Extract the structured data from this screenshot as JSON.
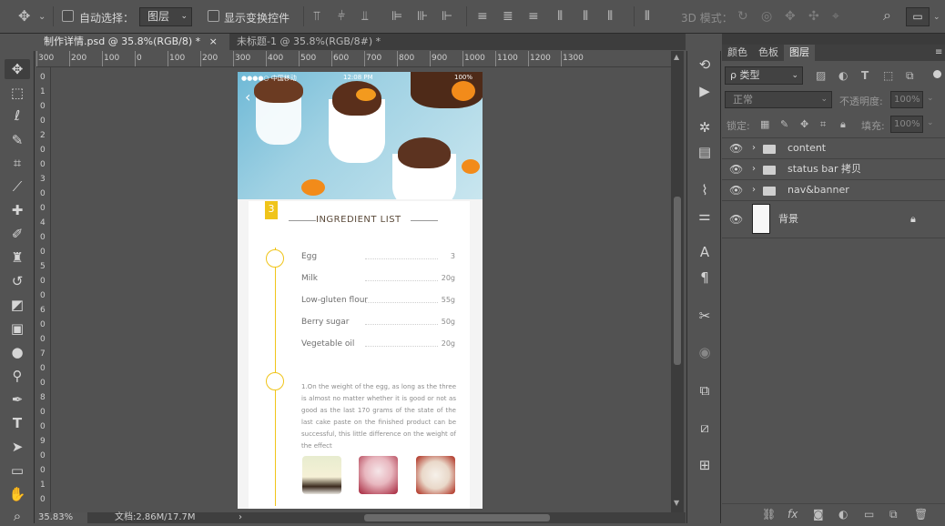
{
  "options": {
    "auto_select_label": "自动选择：",
    "layer_select_value": "图层",
    "show_transform_label": "显示变换控件",
    "mode_3d_label": "3D 模式："
  },
  "tabs": [
    {
      "title": "制作详情.psd @ 35.8%(RGB/8) *",
      "close": "×"
    },
    {
      "title": "未标题-1 @ 35.8%(RGB/8#) *",
      "close": "×"
    }
  ],
  "ruler_top": [
    "300",
    "200",
    "100",
    "0",
    "100",
    "200",
    "300",
    "400",
    "500",
    "600",
    "700",
    "800",
    "900",
    "1000",
    "1100",
    "1200",
    "1300"
  ],
  "ruler_left": [
    "0",
    "1",
    "0",
    "0",
    "2",
    "0",
    "0",
    "3",
    "0",
    "0",
    "4",
    "0",
    "0",
    "5",
    "0",
    "0",
    "6",
    "0",
    "0",
    "7",
    "0",
    "0",
    "8",
    "0",
    "0",
    "9",
    "0",
    "0",
    "1",
    "0"
  ],
  "status": {
    "zoom": "35.83%",
    "doc": "文档:2.86M/17.7M",
    "arrow": "›"
  },
  "panel": {
    "tabs": [
      "颜色",
      "色板",
      "图层"
    ],
    "filter_label": "ρ 类型",
    "blend_mode": "正常",
    "opacity_label": "不透明度:",
    "opacity_value": "100%",
    "lock_label": "锁定:",
    "fill_label": "填充:",
    "fill_value": "100%",
    "layers": [
      {
        "name": "content"
      },
      {
        "name": "status bar 拷贝"
      },
      {
        "name": "nav&banner"
      },
      {
        "name": "背景"
      }
    ]
  },
  "mock": {
    "carrier": "●●●●○ 中国移动",
    "time": "12:08 PM",
    "battery": "100%",
    "badge": "3",
    "title": "INGREDIENT LIST",
    "ingredients": [
      {
        "name": "Egg",
        "qty": "3"
      },
      {
        "name": "Milk",
        "qty": "20g"
      },
      {
        "name": "Low-gluten flour",
        "qty": "55g"
      },
      {
        "name": "Berry sugar",
        "qty": "50g"
      },
      {
        "name": "Vegetable oil",
        "qty": "20g"
      }
    ],
    "paragraph": "1.On the weight of the egg, as long as the three is almost no matter whether it is good or not as good as the last 170 grams of the state of the last cake paste on the finished product can be successful, this little difference on the weight of the effect"
  },
  "colors": {
    "accent": "#f0c419",
    "ps_bg": "#535353",
    "selected_tab": "#535353"
  }
}
